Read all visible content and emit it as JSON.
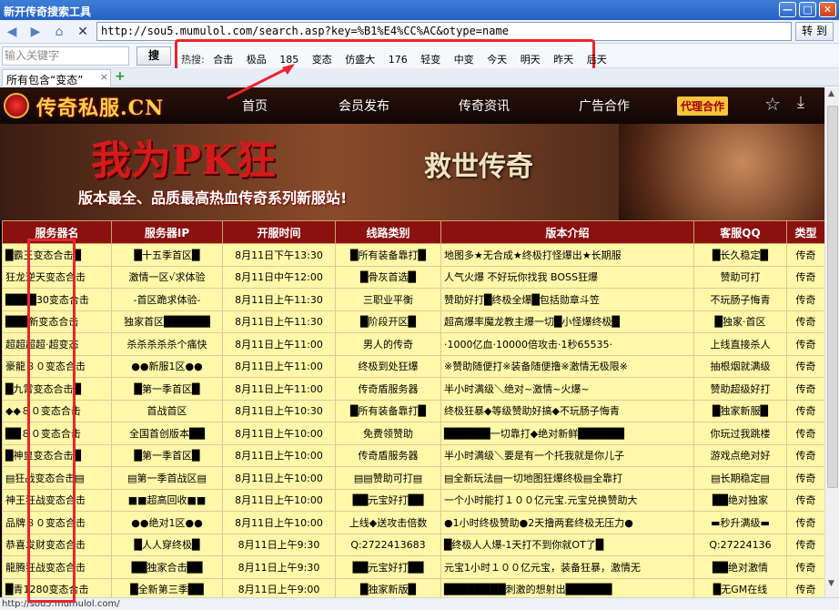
{
  "window": {
    "title": "新开传奇搜索工具",
    "minimize": "—",
    "maximize": "□",
    "close": "✕"
  },
  "addressbar": {
    "url": "http://sou5.mumulol.com/search.asp?key=%B1%E4%CC%AC&otype=name",
    "go_label": "转 到"
  },
  "searchbar": {
    "placeholder": "输入关键字",
    "button_label": "搜",
    "hot_label": "热搜:",
    "hot_keywords": [
      "合击",
      "极品",
      "185",
      "变态",
      "仿盛大",
      "176",
      "轻变",
      "中变",
      "今天",
      "明天",
      "昨天",
      "后天"
    ]
  },
  "tab": {
    "label": "所有包含“变态”",
    "close": "×",
    "new": "+"
  },
  "site": {
    "logo": "传奇私服.CN",
    "nav": [
      "首页",
      "会员发布",
      "传奇资讯",
      "广告合作"
    ],
    "agent": "代理合作",
    "banner_title": "我为PK狂",
    "banner_slogan": "版本最全、品质最高热血传奇系列新服站!",
    "banner_game": "救世传奇"
  },
  "table": {
    "headers": [
      "服务器名",
      "服务器IP",
      "开服时间",
      "线路类别",
      "版本介绍",
      "客服QQ",
      "类型"
    ],
    "rows": [
      [
        "█霸王变态合击█",
        "█十五季首区█",
        "8月11日下午13:30",
        "█所有装备靠打█",
        "地图多★无合成★终极打怪爆出★长期服",
        "█长久稳定█",
        "传奇"
      ],
      [
        "狂龙逆天变态合击",
        "激情一区√求体验",
        "8月11日中午12:00",
        "█骨灰首选█",
        "人气火爆 不好玩你找我 BOSS狂爆",
        "赞助可打",
        "传奇"
      ],
      [
        "████30变态合击",
        "-首区跪求体验-",
        "8月11日上午11:30",
        "三职业平衡",
        "赞助好打█终极全爆█包括勋章斗笠",
        "不玩肠子悔青",
        "传奇"
      ],
      [
        "███新变态合击",
        "独家首区██████",
        "8月11日上午11:30",
        "█阶段开区█",
        "超高爆率魔龙教主爆一切█小怪爆终极█",
        "█独家·首区",
        "传奇"
      ],
      [
        "超超超超·超变态",
        "杀杀杀杀杀个痛快",
        "8月11日上午11:00",
        "男人的传奇",
        "·1000亿血·10000倍攻击·1秒65535·",
        "上线直接杀人",
        "传奇"
      ],
      [
        "豪龍８０变态合击",
        "●●新服1区●●",
        "8月11日上午11:00",
        "终极到处狂爆",
        "※赞助随便打※装备随便撸※激情无极限※",
        "抽根烟就满级",
        "传奇"
      ],
      [
        "█九霄变态合击█",
        "█第一季首区█",
        "8月11日上午11:00",
        "传奇盾服务器",
        "半小时满级＼绝对~激情~火爆~",
        "赞助超级好打",
        "传奇"
      ],
      [
        "◆◆８０变态合击",
        "首战首区",
        "8月11日上午10:30",
        "█所有装备靠打█",
        "终极狂暴◆等级赞助好搞◆不玩肠子悔青",
        "█独家新服█",
        "传奇"
      ],
      [
        "██８０变态合击",
        "全国首创版本██",
        "8月11日上午10:00",
        "免费领赞助",
        "██████一切靠打◆绝对新鲜██████",
        "你玩过我跳楼",
        "传奇"
      ],
      [
        "█神皇变态合击█",
        "█第一季首区█",
        "8月11日上午10:00",
        "传奇盾服务器",
        "半小时满级＼要是有一个托我就是你儿子",
        "游戏点绝对好",
        "传奇"
      ],
      [
        "▤狂战变态合击▤",
        "▤第一季首战区▤",
        "8月11日上午10:00",
        "▤▤赞助可打▤",
        "▤全新玩法▤一切地图狂爆终极▤全靠打",
        "▤长期稳定▤",
        "传奇"
      ],
      [
        "神王狂战变态合击",
        "■■超高回收■■",
        "8月11日上午10:00",
        "██元宝好打██",
        "一个小时能打１００亿元宝.元宝兑换赞助大",
        "██绝对独家",
        "传奇"
      ],
      [
        "品牌８０变态合击",
        "●●绝对1区●●",
        "8月11日上午10:00",
        "上线◆送攻击倍数",
        "●1小时终极赞助●2天撸两套终极无压力●",
        "▬秒升满级▬",
        "传奇"
      ],
      [
        "恭喜发财变态合击",
        "█人人穿终极█",
        "8月11日上午9:30",
        "Q:2722413683",
        "█终极人人爆-1天打不到你就OT了█",
        "Q:27224136",
        "传奇"
      ],
      [
        "龍腾狂战变态合击",
        "██独家合击██",
        "8月11日上午9:30",
        "██元宝好打██",
        "元宝1小时１００亿元宝，装备狂暴，激情无",
        "██绝对激情",
        "传奇"
      ],
      [
        "█青1280变态合击",
        "█全新第三季██",
        "8月11日上午9:00",
        "█独家新版█",
        "████████刺激的想射出██████",
        "█无GM在线",
        "传奇"
      ]
    ]
  },
  "statusbar": {
    "text": "http://sou5.mumulol.com/"
  }
}
